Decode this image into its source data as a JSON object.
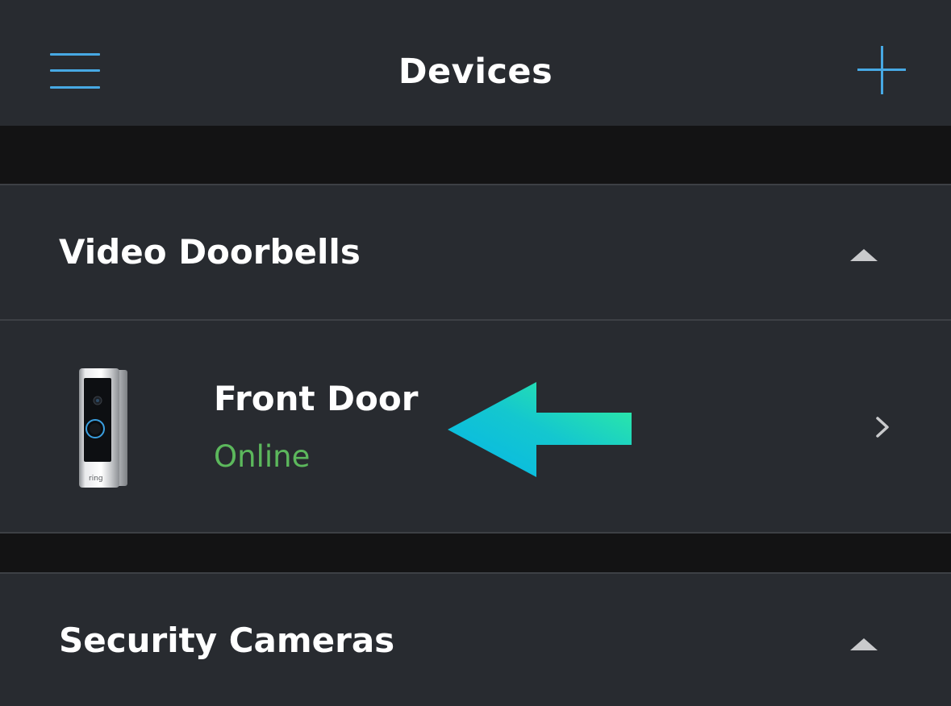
{
  "header": {
    "title": "Devices",
    "menu_icon": "hamburger-menu-icon",
    "add_icon": "plus-icon",
    "accent_color": "#47a9e4"
  },
  "sections": [
    {
      "title": "Video Doorbells",
      "toggle_icon": "caret-up-icon",
      "devices": [
        {
          "name": "Front Door",
          "status": "Online",
          "status_color": "#5cb85c",
          "image": "video-doorbell-icon",
          "brand_mark": "ring",
          "chevron_icon": "chevron-right-icon"
        }
      ]
    },
    {
      "title": "Security Cameras",
      "toggle_icon": "caret-up-icon",
      "devices": []
    }
  ],
  "annotation": {
    "icon": "pointer-arrow-icon",
    "colors": [
      "#0cbde6",
      "#2ef29c"
    ]
  }
}
